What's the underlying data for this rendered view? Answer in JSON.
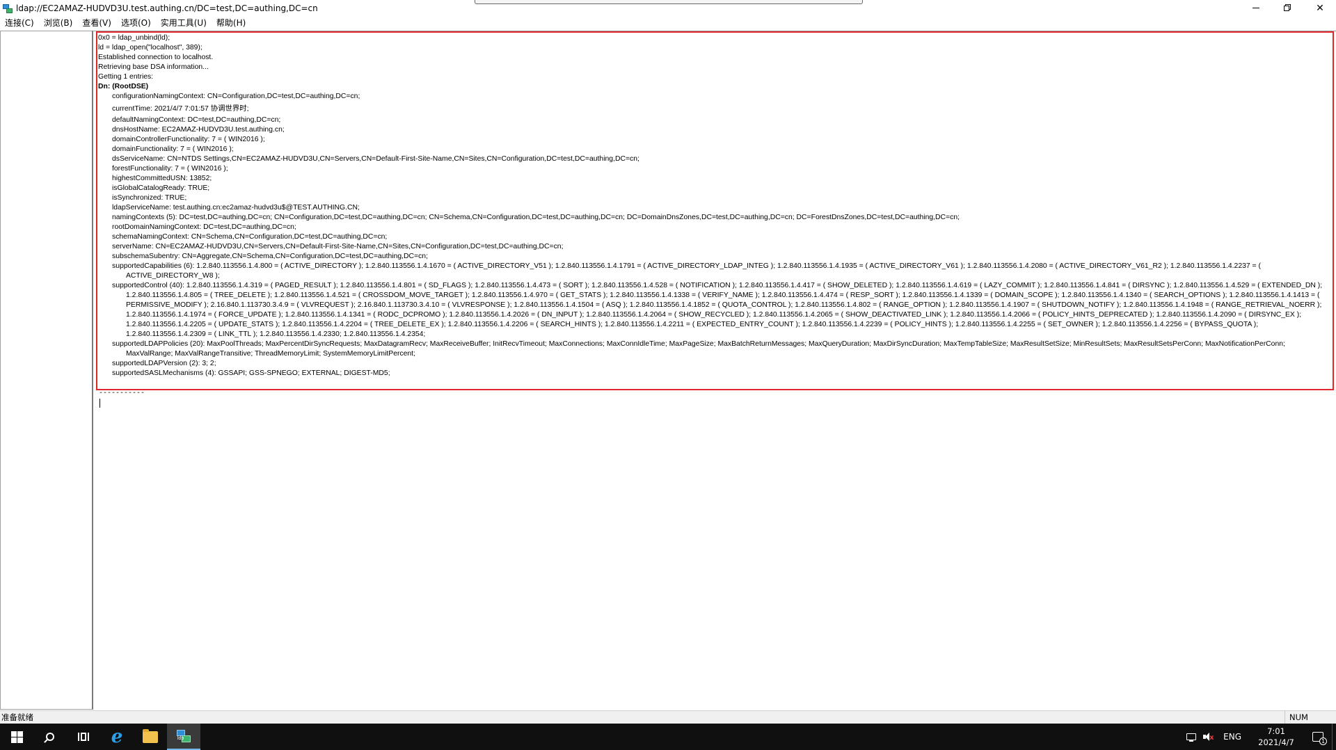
{
  "window": {
    "title": "ldap://EC2AMAZ-HUDVD3U.test.authing.cn/DC=test,DC=authing,DC=cn",
    "close_glyph": "✕"
  },
  "menu": [
    "连接(C)",
    "浏览(B)",
    "查看(V)",
    "选项(O)",
    "实用工具(U)",
    "帮助(H)"
  ],
  "log": {
    "header_lines": [
      "0x0 = ldap_unbind(ld);",
      "ld = ldap_open(\"localhost\", 389);",
      "Established connection to localhost.",
      "Retrieving base DSA information...",
      "Getting 1 entries:"
    ],
    "dn_line": "Dn: (RootDSE)",
    "attributes": [
      {
        "text": "configurationNamingContext: CN=Configuration,DC=test,DC=authing,DC=cn;",
        "style": ""
      },
      {
        "text": "currentTime: 2021/4/7 7:01:57 协调世界时;",
        "style": "tall"
      },
      {
        "text": "defaultNamingContext: DC=test,DC=authing,DC=cn;",
        "style": ""
      },
      {
        "text": "dnsHostName: EC2AMAZ-HUDVD3U.test.authing.cn;",
        "style": ""
      },
      {
        "text": "domainControllerFunctionality: 7 = ( WIN2016 );",
        "style": ""
      },
      {
        "text": "domainFunctionality: 7 = ( WIN2016 );",
        "style": ""
      },
      {
        "text": "dsServiceName: CN=NTDS Settings,CN=EC2AMAZ-HUDVD3U,CN=Servers,CN=Default-First-Site-Name,CN=Sites,CN=Configuration,DC=test,DC=authing,DC=cn;",
        "style": ""
      },
      {
        "text": "forestFunctionality: 7 = ( WIN2016 );",
        "style": ""
      },
      {
        "text": "highestCommittedUSN: 13852;",
        "style": ""
      },
      {
        "text": "isGlobalCatalogReady: TRUE;",
        "style": ""
      },
      {
        "text": "isSynchronized: TRUE;",
        "style": ""
      },
      {
        "text": "ldapServiceName: test.authing.cn:ec2amaz-hudvd3u$@TEST.AUTHING.CN;",
        "style": ""
      },
      {
        "text": "namingContexts (5): DC=test,DC=authing,DC=cn; CN=Configuration,DC=test,DC=authing,DC=cn; CN=Schema,CN=Configuration,DC=test,DC=authing,DC=cn; DC=DomainDnsZones,DC=test,DC=authing,DC=cn; DC=ForestDnsZones,DC=test,DC=authing,DC=cn;",
        "style": ""
      },
      {
        "text": "rootDomainNamingContext: DC=test,DC=authing,DC=cn;",
        "style": ""
      },
      {
        "text": "schemaNamingContext: CN=Schema,CN=Configuration,DC=test,DC=authing,DC=cn;",
        "style": ""
      },
      {
        "text": "serverName: CN=EC2AMAZ-HUDVD3U,CN=Servers,CN=Default-First-Site-Name,CN=Sites,CN=Configuration,DC=test,DC=authing,DC=cn;",
        "style": ""
      },
      {
        "text": "subschemaSubentry: CN=Aggregate,CN=Schema,CN=Configuration,DC=test,DC=authing,DC=cn;",
        "style": ""
      },
      {
        "text": "supportedCapabilities (6): 1.2.840.113556.1.4.800 = ( ACTIVE_DIRECTORY ); 1.2.840.113556.1.4.1670 = ( ACTIVE_DIRECTORY_V51 ); 1.2.840.113556.1.4.1791 = ( ACTIVE_DIRECTORY_LDAP_INTEG ); 1.2.840.113556.1.4.1935 = ( ACTIVE_DIRECTORY_V61 ); 1.2.840.113556.1.4.2080 = ( ACTIVE_DIRECTORY_V61_R2 ); 1.2.840.113556.1.4.2237 = ( ACTIVE_DIRECTORY_W8 );",
        "style": "wrap"
      },
      {
        "text": "supportedControl (40): 1.2.840.113556.1.4.319 = ( PAGED_RESULT ); 1.2.840.113556.1.4.801 = ( SD_FLAGS ); 1.2.840.113556.1.4.473 = ( SORT ); 1.2.840.113556.1.4.528 = ( NOTIFICATION ); 1.2.840.113556.1.4.417 = ( SHOW_DELETED ); 1.2.840.113556.1.4.619 = ( LAZY_COMMIT ); 1.2.840.113556.1.4.841 = ( DIRSYNC ); 1.2.840.113556.1.4.529 = ( EXTENDED_DN ); 1.2.840.113556.1.4.805 = ( TREE_DELETE ); 1.2.840.113556.1.4.521 = ( CROSSDOM_MOVE_TARGET ); 1.2.840.113556.1.4.970 = ( GET_STATS ); 1.2.840.113556.1.4.1338 = ( VERIFY_NAME ); 1.2.840.113556.1.4.474 = ( RESP_SORT ); 1.2.840.113556.1.4.1339 = ( DOMAIN_SCOPE ); 1.2.840.113556.1.4.1340 = ( SEARCH_OPTIONS ); 1.2.840.113556.1.4.1413 = ( PERMISSIVE_MODIFY ); 2.16.840.1.113730.3.4.9 = ( VLVREQUEST ); 2.16.840.1.113730.3.4.10 = ( VLVRESPONSE ); 1.2.840.113556.1.4.1504 = ( ASQ ); 1.2.840.113556.1.4.1852 = ( QUOTA_CONTROL ); 1.2.840.113556.1.4.802 = ( RANGE_OPTION ); 1.2.840.113556.1.4.1907 = ( SHUTDOWN_NOTIFY ); 1.2.840.113556.1.4.1948 = ( RANGE_RETRIEVAL_NOERR ); 1.2.840.113556.1.4.1974 = ( FORCE_UPDATE ); 1.2.840.113556.1.4.1341 = ( RODC_DCPROMO ); 1.2.840.113556.1.4.2026 = ( DN_INPUT ); 1.2.840.113556.1.4.2064 = ( SHOW_RECYCLED ); 1.2.840.113556.1.4.2065 = ( SHOW_DEACTIVATED_LINK ); 1.2.840.113556.1.4.2066 = ( POLICY_HINTS_DEPRECATED ); 1.2.840.113556.1.4.2090 = ( DIRSYNC_EX ); 1.2.840.113556.1.4.2205 = ( UPDATE_STATS ); 1.2.840.113556.1.4.2204 = ( TREE_DELETE_EX ); 1.2.840.113556.1.4.2206 = ( SEARCH_HINTS ); 1.2.840.113556.1.4.2211 = ( EXPECTED_ENTRY_COUNT ); 1.2.840.113556.1.4.2239 = ( POLICY_HINTS ); 1.2.840.113556.1.4.2255 = ( SET_OWNER ); 1.2.840.113556.1.4.2256 = ( BYPASS_QUOTA ); 1.2.840.113556.1.4.2309 = ( LINK_TTL ); 1.2.840.113556.1.4.2330; 1.2.840.113556.1.4.2354;",
        "style": "wrap"
      },
      {
        "text": "supportedLDAPPolicies (20): MaxPoolThreads; MaxPercentDirSyncRequests; MaxDatagramRecv; MaxReceiveBuffer; InitRecvTimeout; MaxConnections; MaxConnIdleTime; MaxPageSize; MaxBatchReturnMessages; MaxQueryDuration; MaxDirSyncDuration; MaxTempTableSize; MaxResultSetSize; MinResultSets; MaxResultSetsPerConn; MaxNotificationPerConn; MaxValRange; MaxValRangeTransitive; ThreadMemoryLimit; SystemMemoryLimitPercent;",
        "style": "wrap"
      },
      {
        "text": "supportedLDAPVersion (2): 3; 2;",
        "style": ""
      },
      {
        "text": "supportedSASLMechanisms (4): GSSAPI; GSS-SPNEGO; EXTERNAL; DIGEST-MD5;",
        "style": ""
      }
    ],
    "separator": "-----------"
  },
  "statusbar": {
    "text": "准备就绪",
    "num": "NUM"
  },
  "taskbar": {
    "apps": [
      {
        "name": "start-button",
        "icon": "windows-logo-icon"
      },
      {
        "name": "search-button",
        "icon": "search-icon"
      },
      {
        "name": "task-view-button",
        "icon": "task-view-icon"
      },
      {
        "name": "internet-explorer-button",
        "icon": "internet-explorer-icon"
      },
      {
        "name": "file-explorer-button",
        "icon": "folder-icon"
      },
      {
        "name": "ldp-app-button",
        "icon": "ldp-icon"
      }
    ],
    "ie_glyph": "e",
    "ldp_label": "ldp",
    "language": "ENG",
    "time": "7:01",
    "date": "2021/4/7",
    "notification_count": "1",
    "volume_muted_glyph": "x"
  },
  "colors": {
    "highlight_border": "#e0262a",
    "taskbar_bg": "#101010",
    "active_app_accent": "#76b9ed"
  }
}
